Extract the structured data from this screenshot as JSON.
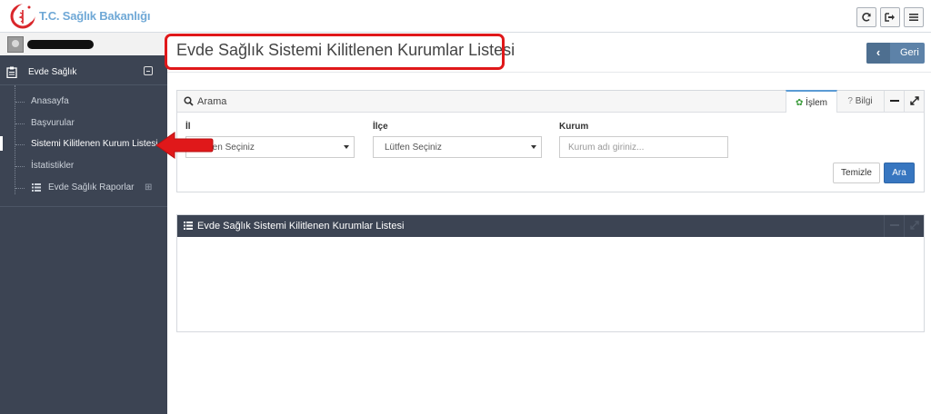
{
  "brand": {
    "name": "T.C. Sağlık Bakanlığı"
  },
  "topbar": {
    "buttons": [
      {
        "name": "refresh-button",
        "icon": "refresh-icon"
      },
      {
        "name": "logout-button",
        "icon": "sign-out-icon"
      },
      {
        "name": "menu-button",
        "icon": "hamburger-menu-icon"
      }
    ]
  },
  "sidebar": {
    "section": {
      "label": "Evde Sağlık",
      "icon": "clipboard-icon"
    },
    "items": [
      {
        "label": "Anasayfa"
      },
      {
        "label": "Başvurular"
      },
      {
        "label": "Sistemi Kilitlenen Kurum Listesi",
        "active": true
      },
      {
        "label": "İstatistikler"
      },
      {
        "label": "Evde Sağlık Raporlar",
        "icon": "list-icon",
        "expand_icon": "plus-square-icon"
      }
    ]
  },
  "header": {
    "title": "Evde Sağlık Sistemi Kilitlenen Kurumlar Listesi",
    "back_label": "Geri"
  },
  "search_panel": {
    "title": "Arama",
    "tabs": [
      {
        "label": "İşlem",
        "icon": "gear-icon",
        "active": true
      },
      {
        "label": "Bilgi",
        "icon": "question-icon"
      }
    ],
    "fields": {
      "il": {
        "label": "İl",
        "value": "Lütfen Seçiniz"
      },
      "ilce": {
        "label": "İlçe",
        "value": "Lütfen Seçiniz"
      },
      "kurum": {
        "label": "Kurum",
        "placeholder": "Kurum adı giriniz..."
      }
    },
    "clear_label": "Temizle",
    "search_label": "Ara"
  },
  "results_panel": {
    "title": "Evde Sağlık Sistemi Kilitlenen Kurumlar Listesi"
  },
  "colors": {
    "sidebar_bg": "#3c4453",
    "annotation_red": "#e0181a",
    "primary_button": "#3776c0",
    "back_button": "#5d82a8"
  }
}
